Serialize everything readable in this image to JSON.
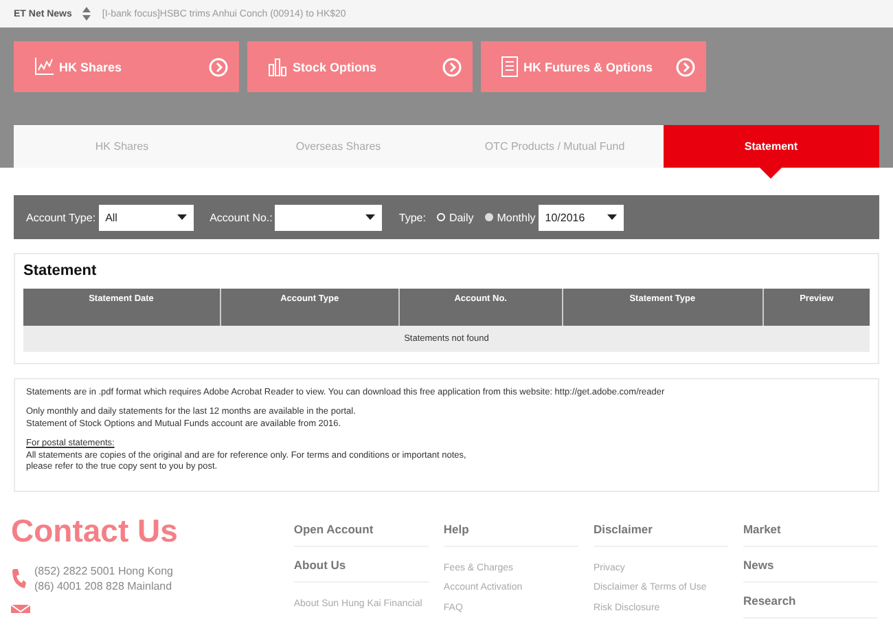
{
  "news": {
    "source": "ET Net News",
    "headline": "[I-bank focus]HSBC trims Anhui Conch (00914) to HK$20"
  },
  "quick_links": [
    {
      "label": "HK Shares",
      "kind": "chart"
    },
    {
      "label": "Stock Options",
      "kind": "bars"
    },
    {
      "label": "HK Futures & Options",
      "kind": "document"
    }
  ],
  "tabs": [
    {
      "label": "HK Shares",
      "selected": false
    },
    {
      "label": "Overseas Shares",
      "selected": false
    },
    {
      "label": "OTC Products / Mutual Fund",
      "selected": false
    },
    {
      "label": "Statement",
      "selected": true
    }
  ],
  "filters": {
    "account_type": {
      "label": "Account Type:",
      "value": "All"
    },
    "account_no": {
      "label": "Account No.:"
    },
    "type": {
      "label": "Type:",
      "options": [
        {
          "label": "Daily",
          "selected": true
        },
        {
          "label": "Monthly",
          "selected": false
        }
      ]
    },
    "period": {
      "value": "10/2016"
    }
  },
  "statement": {
    "title": "Statement",
    "columns": [
      "Statement Date",
      "Account Type",
      "Account No.",
      "Statement Type",
      "Preview"
    ],
    "empty_message": "Statements not found"
  },
  "notes": [
    {
      "kind": "text",
      "lines": [
        "Statements are in .pdf format which requires Adobe Acrobat Reader to view. You can download this free application from this website: http://get.adobe.com/reader"
      ]
    },
    {
      "kind": "text",
      "lines": [
        "Only monthly and daily statements for the last 12 months are available in the portal.",
        "Statement of Stock Options and Mutual Funds account are available from 2016."
      ]
    },
    {
      "kind": "heading",
      "lines": [
        "For postal statements:"
      ]
    },
    {
      "kind": "text",
      "lines": [
        "All statements are copies of the original and are for reference only. For terms and conditions or important notes,",
        "please refer to the true copy sent to you by post."
      ]
    }
  ],
  "footer": {
    "contact_title": "Contact Us",
    "phones": [
      "(852) 2822 5001 Hong Kong",
      "(86) 4001 208 828 Mainland"
    ],
    "columns": [
      [
        {
          "label": "Open Account",
          "kind": "heading"
        },
        {
          "label": "About Us",
          "kind": "heading"
        },
        {
          "label": "About Sun Hung Kai Financial",
          "kind": "link"
        }
      ],
      [
        {
          "label": "Help",
          "kind": "heading"
        },
        {
          "label": "Fees & Charges",
          "kind": "link"
        },
        {
          "label": "Account Activation",
          "kind": "link"
        },
        {
          "label": "FAQ",
          "kind": "link"
        }
      ],
      [
        {
          "label": "Disclaimer",
          "kind": "heading"
        },
        {
          "label": "Privacy",
          "kind": "link"
        },
        {
          "label": "Disclaimer & Terms of Use",
          "kind": "link"
        },
        {
          "label": "Risk Disclosure",
          "kind": "link"
        }
      ],
      [
        {
          "label": "Market",
          "kind": "heading"
        },
        {
          "label": "News",
          "kind": "heading"
        },
        {
          "label": "Research",
          "kind": "heading"
        }
      ]
    ]
  }
}
